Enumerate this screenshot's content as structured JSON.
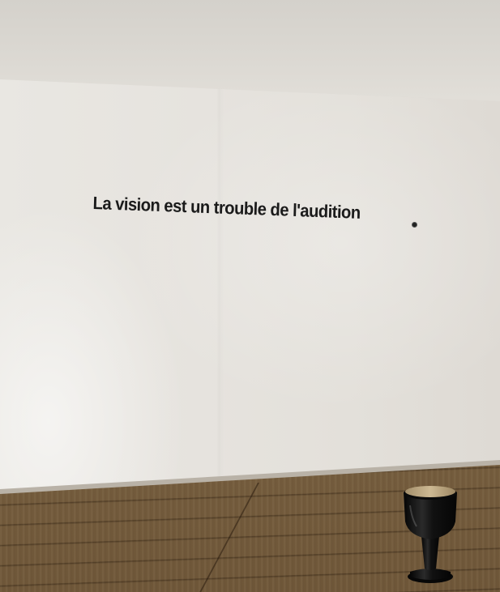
{
  "wall_text": "La vision est un trouble de l'audition",
  "colors": {
    "wall": "#e6e3de",
    "floor": "#7f6645",
    "text": "#1b1b1b",
    "stool_body": "#141414",
    "stool_seat": "#bda882"
  },
  "objects": [
    "wall-inscription",
    "wall-dot",
    "wooden-floor",
    "black-stool"
  ]
}
